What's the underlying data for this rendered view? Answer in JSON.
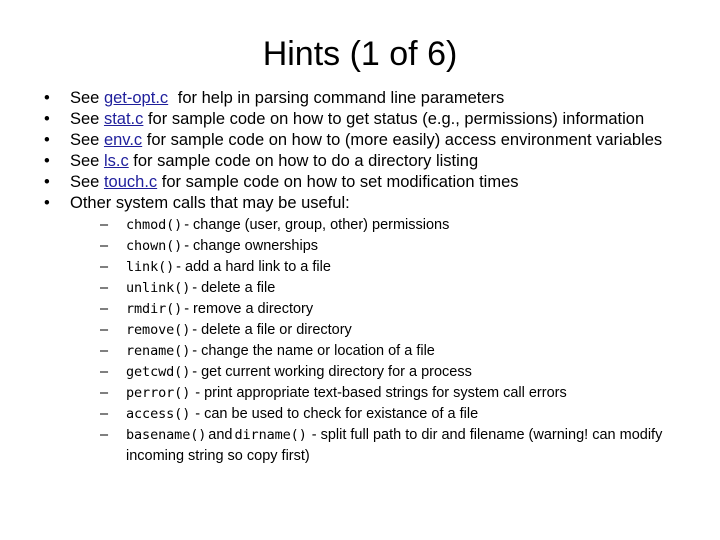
{
  "slide": {
    "title": "Hints (1 of 6)",
    "bullet_marker": "•",
    "sub_bullet_marker": "–",
    "link_color": "#1f1f9c",
    "text_color": "#000000",
    "background_color": "#ffffff"
  },
  "bullets": [
    {
      "pre": "See ",
      "link": "get-opt.c",
      "post": " for help in parsing command line parameters"
    },
    {
      "pre": "See ",
      "link": "stat.c",
      "post": " for sample code on how to get status (e.g., permissions) information"
    },
    {
      "pre": "See ",
      "link": "env.c",
      "post": " for sample code on how to (more easily) access environment variables"
    },
    {
      "pre": "See ",
      "link": "ls.c",
      "post": " for sample code on how to do a directory listing"
    },
    {
      "pre": "See ",
      "link": "touch.c",
      "post": " for sample code on how to set modification times"
    },
    {
      "pre": "Other system calls that may be useful:",
      "link": "",
      "post": ""
    }
  ],
  "syscalls": [
    {
      "name": "chmod()",
      "desc": "- change (user, group, other) permissions"
    },
    {
      "name": "chown()",
      "desc": "- change ownerships"
    },
    {
      "name": "link()",
      "desc": "- add a hard link to a file"
    },
    {
      "name": "unlink()",
      "desc": "- delete a file"
    },
    {
      "name": "rmdir()",
      "desc": "- remove a directory"
    },
    {
      "name": "remove()",
      "desc": "- delete a file or directory"
    },
    {
      "name": "rename()",
      "desc": "- change the name or location of a file"
    },
    {
      "name": "getcwd()",
      "desc": "- get current working directory for a process"
    },
    {
      "name": "perror()",
      "desc": "- print appropriate text-based strings for system call errors"
    },
    {
      "name": "access()",
      "desc": "- can be used to check for existance of a file"
    }
  ],
  "last_syscall": {
    "name1": "basename()",
    "conjunction": "and",
    "name2": "dirname()",
    "desc": "- split full path to dir and filename (warning! can modify incoming string so copy first)"
  }
}
